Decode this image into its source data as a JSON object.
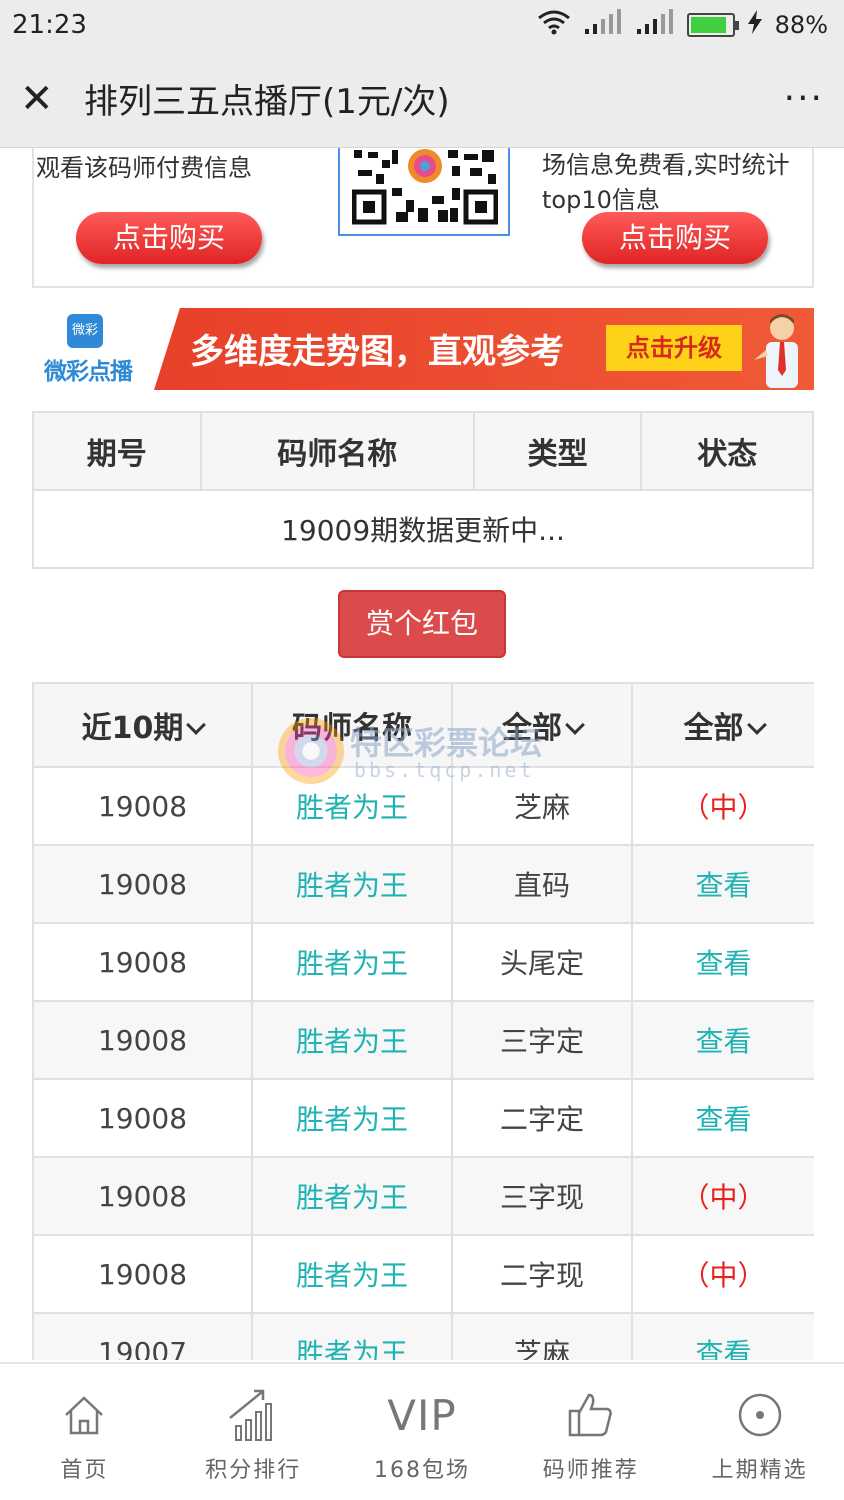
{
  "status_bar": {
    "time": "21:23",
    "battery": "88%",
    "battery_fill": 0.88
  },
  "titlebar": {
    "close": "✕",
    "title": "排列三五点播厅(1元/次)",
    "more": "···"
  },
  "promo": {
    "left_text": "观看该码师付费信息",
    "right_text": "场信息免费看,实时统计top10信息",
    "left_button": "点击购买",
    "right_button": "点击购买"
  },
  "banner": {
    "logo_badge": "微彩",
    "logo_name": "微彩点播",
    "slogan": "多维度走势图，直观参考",
    "upgrade": "点击升级"
  },
  "table1": {
    "headers": [
      "期号",
      "码师名称",
      "类型",
      "状态"
    ],
    "message": "19009期数据更新中..."
  },
  "reward_button": "赏个红包",
  "table2": {
    "headers": {
      "period": "近10期",
      "name": "码师名称",
      "type": "全部",
      "status": "全部"
    },
    "rows": [
      {
        "period": "19008",
        "name": "胜者为王",
        "type": "芝麻",
        "status": "（中）",
        "win": true
      },
      {
        "period": "19008",
        "name": "胜者为王",
        "type": "直码",
        "status": "查看",
        "win": false
      },
      {
        "period": "19008",
        "name": "胜者为王",
        "type": "头尾定",
        "status": "查看",
        "win": false
      },
      {
        "period": "19008",
        "name": "胜者为王",
        "type": "三字定",
        "status": "查看",
        "win": false
      },
      {
        "period": "19008",
        "name": "胜者为王",
        "type": "二字定",
        "status": "查看",
        "win": false
      },
      {
        "period": "19008",
        "name": "胜者为王",
        "type": "三字现",
        "status": "（中）",
        "win": true
      },
      {
        "period": "19008",
        "name": "胜者为王",
        "type": "二字现",
        "status": "（中）",
        "win": true
      },
      {
        "period": "19007",
        "name": "胜者为王",
        "type": "芝麻",
        "status": "查看",
        "win": false
      }
    ]
  },
  "watermark": {
    "title": "特区彩票论坛",
    "url": "bbs.tqcp.net"
  },
  "bottom_nav": [
    {
      "label": "首页",
      "icon": "home-icon"
    },
    {
      "label": "积分排行",
      "icon": "ranking-chart-icon"
    },
    {
      "label": "168包场",
      "icon": "vip-icon",
      "icon_text": "VIP"
    },
    {
      "label": "码师推荐",
      "icon": "thumbs-up-icon"
    },
    {
      "label": "上期精选",
      "icon": "record-circle-icon"
    }
  ],
  "colors": {
    "teal": "#1fb3b3",
    "win_red": "#e8221e",
    "button_red": "#dc4b4b",
    "banner_orange": "#e8402a",
    "upgrade_yellow": "#ffd21a"
  }
}
